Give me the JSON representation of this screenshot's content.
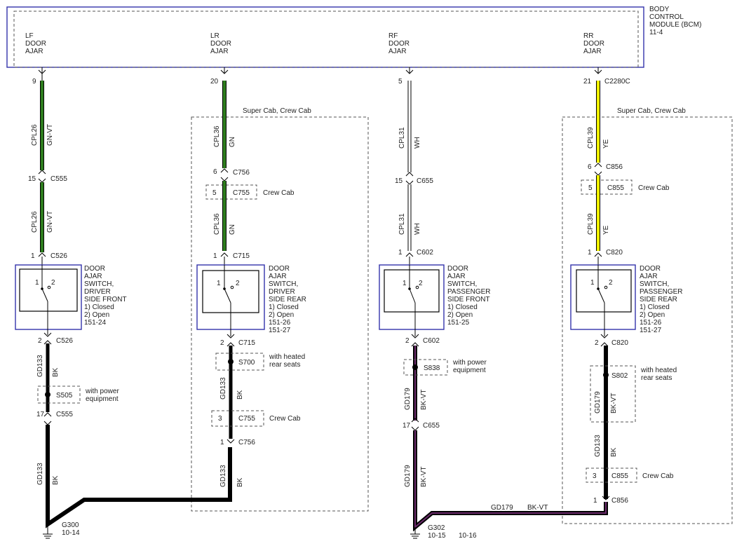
{
  "bcm": {
    "title": [
      "BODY",
      "CONTROL",
      "MODULE (BCM)",
      "11-4"
    ],
    "lf": [
      "LF",
      "DOOR",
      "AJAR"
    ],
    "lr": [
      "LR",
      "DOOR",
      "AJAR"
    ],
    "rf": [
      "RF",
      "DOOR",
      "AJAR"
    ],
    "rr": [
      "RR",
      "DOOR",
      "AJAR"
    ]
  },
  "pins": {
    "lf_bcm": "9",
    "lr_bcm": "20",
    "rf_bcm": "5",
    "rr_bcm": "21",
    "rr_bcm_conn": "C2280C",
    "c555_15": "15",
    "c555": "C555",
    "c526_1": "1",
    "c526": "C526",
    "c526_2": "2",
    "c555_17": "17",
    "c555_b": "C555",
    "c756_6": "6",
    "c756": "C756",
    "c755_5": "5",
    "c755": "C755",
    "c715_1": "1",
    "c715": "C715",
    "c715_2": "2",
    "c715_b": "C715",
    "c755_3": "3",
    "c755_b": "C755",
    "c756_1": "1",
    "c756_b": "C756",
    "c655_15": "15",
    "c655": "C655",
    "c602_1": "1",
    "c602": "C602",
    "c602_2": "2",
    "c602_b": "C602",
    "c655_17": "17",
    "c655_b": "C655",
    "c856_6": "6",
    "c856": "C856",
    "c855_5": "5",
    "c855": "C855",
    "c820_1": "1",
    "c820": "C820",
    "c820_2": "2",
    "c820_b": "C820",
    "c855_3": "3",
    "c855_b": "C855",
    "c856_1": "1",
    "c856_b": "C856"
  },
  "wires": {
    "cpl26": "CPL26",
    "gnvt": "GN-VT",
    "cpl36": "CPL36",
    "gn": "GN",
    "cpl31": "CPL31",
    "wh": "WH",
    "cpl39": "CPL39",
    "ye": "YE",
    "gd133": "GD133",
    "bk": "BK",
    "gd179": "GD179",
    "bkvt": "BK-VT"
  },
  "notes": {
    "super_crew": "Super Cab, Crew Cab",
    "crew_cab": "Crew Cab",
    "with_power": [
      "with power",
      "equipment"
    ],
    "with_heated": [
      "with heated",
      "rear seats"
    ]
  },
  "splices": {
    "s505": "S505",
    "s700": "S700",
    "s838": "S838",
    "s802": "S802"
  },
  "switches": {
    "lf": [
      "DOOR",
      "AJAR",
      "SWITCH,",
      "DRIVER",
      "SIDE FRONT",
      "1) Closed",
      "2) Open",
      "151-24"
    ],
    "lr": [
      "DOOR",
      "AJAR",
      "SWITCH,",
      "DRIVER",
      "SIDE REAR",
      "1) Closed",
      "2) Open",
      "151-26",
      "151-27"
    ],
    "rf": [
      "DOOR",
      "AJAR",
      "SWITCH,",
      "PASSENGER",
      "SIDE FRONT",
      "1) Closed",
      "2) Open",
      "151-25"
    ],
    "rr": [
      "DOOR",
      "AJAR",
      "SWITCH,",
      "PASSENGER",
      "SIDE REAR",
      "1) Closed",
      "2) Open",
      "151-26",
      "151-27"
    ],
    "pin1": "1",
    "pin2": "2"
  },
  "grounds": {
    "g300": "G300",
    "g300_ref": "10-14",
    "g302": "G302",
    "g302_ref1": "10-15",
    "g302_ref2": "10-16"
  },
  "colors": {
    "green": "#2e7d1e",
    "yellow": "#f2f200",
    "purple": "#6a2a6a",
    "border": "#3333aa"
  }
}
